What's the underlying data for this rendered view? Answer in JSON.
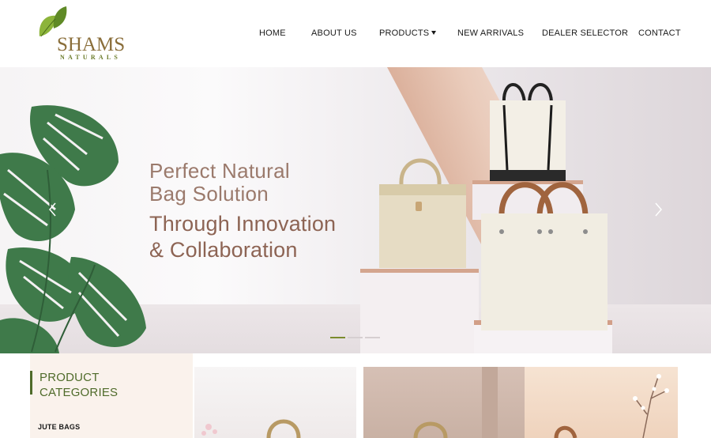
{
  "brand": {
    "name": "SHAMS",
    "tagline": "NATURALS",
    "colors": {
      "leaf": "#7a9a2e",
      "gold": "#8a6e3a",
      "accent": "#4f6b2a"
    }
  },
  "nav": {
    "items": [
      {
        "label": "HOME"
      },
      {
        "label": "ABOUT US"
      },
      {
        "label": "PRODUCTS",
        "has_dropdown": true
      },
      {
        "label": "NEW ARRIVALS"
      },
      {
        "label": "DEALER SELECTOR"
      },
      {
        "label": "CONTACT"
      }
    ]
  },
  "hero": {
    "line1": "Perfect Natural",
    "line2": "Bag Solution",
    "line3": "Through Innovation",
    "line4": "& Collaboration",
    "prev_icon": "chevron-left-icon",
    "next_icon": "chevron-right-icon",
    "slides_total": 3,
    "active_slide": 1
  },
  "categories": {
    "title_line1": "PRODUCT",
    "title_line2": "CATEGORIES",
    "items": [
      {
        "label": "JUTE BAGS"
      }
    ]
  },
  "product_cards": [
    {
      "name": "product-card-1"
    },
    {
      "name": "product-card-2"
    },
    {
      "name": "product-card-3"
    }
  ]
}
